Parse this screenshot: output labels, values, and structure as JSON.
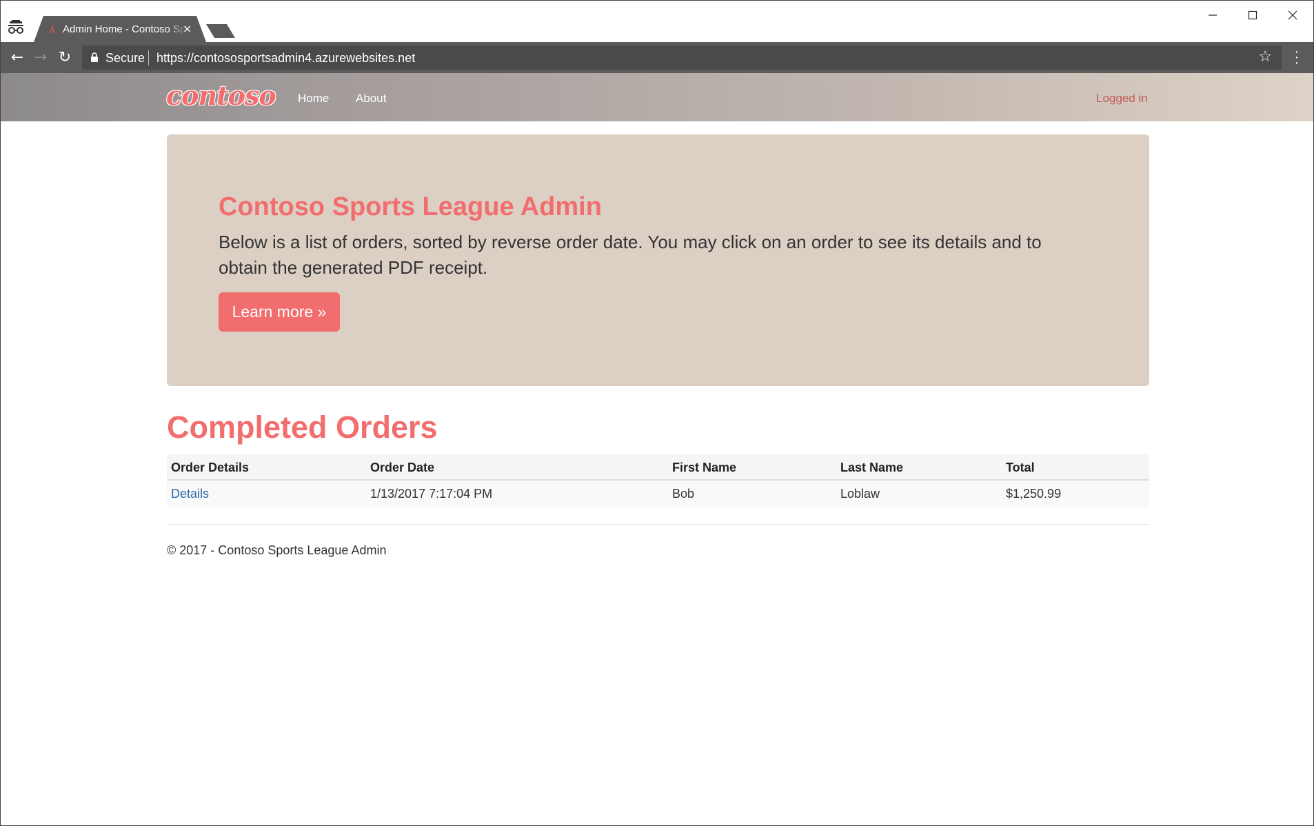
{
  "browser": {
    "tab_title": "Admin Home - Contoso Sports League Admin",
    "tab_close": "×",
    "secure_label": "Secure",
    "url": "https://contososportsadmin4.azurewebsites.net"
  },
  "navbar": {
    "logo": "contoso",
    "links": [
      {
        "label": "Home"
      },
      {
        "label": "About"
      }
    ],
    "login_status": "Logged in"
  },
  "jumbotron": {
    "title": "Contoso Sports League Admin",
    "text": "Below is a list of orders, sorted by reverse order date. You may click on an order to see its details and to obtain the generated PDF receipt.",
    "button": "Learn more »"
  },
  "orders": {
    "heading": "Completed Orders",
    "columns": [
      "Order Details",
      "Order Date",
      "First Name",
      "Last Name",
      "Total"
    ],
    "rows": [
      {
        "details": "Details",
        "date": "1/13/2017 7:17:04 PM",
        "first": "Bob",
        "last": "Loblaw",
        "total": "$1,250.99"
      }
    ]
  },
  "footer": {
    "text": "© 2017 - Contoso Sports League Admin"
  },
  "colors": {
    "accent": "#f26d6d",
    "jumbotron_bg": "#dcd0c4",
    "toolbar_bg": "#5b5b5b",
    "link": "#2a6aa8"
  }
}
